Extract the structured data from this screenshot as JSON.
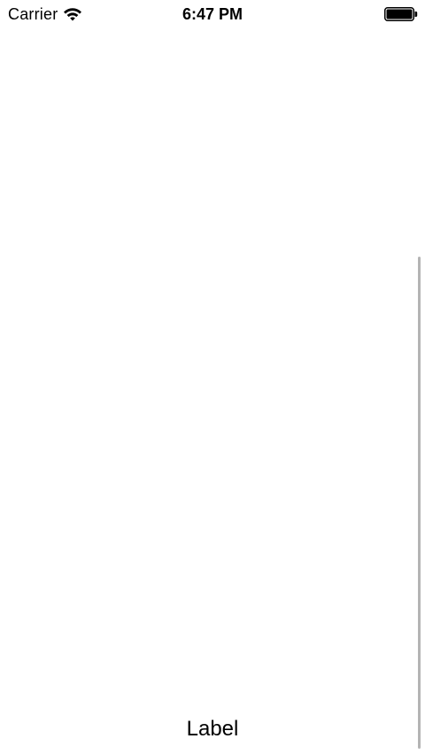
{
  "status_bar": {
    "carrier": "Carrier",
    "time": "6:47 PM",
    "wifi_icon": "wifi-icon",
    "battery_icon": "battery-icon"
  },
  "content": {
    "label": "Label"
  },
  "colors": {
    "background": "#ffffff",
    "text": "#000000",
    "scroll_indicator": "#b4b4b4"
  }
}
